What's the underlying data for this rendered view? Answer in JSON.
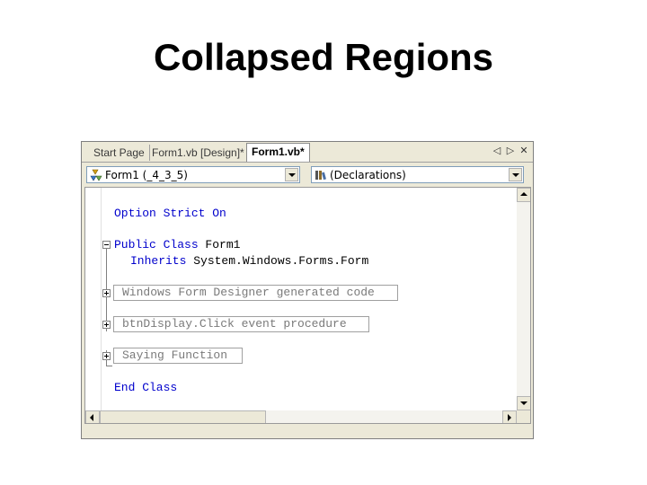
{
  "slide": {
    "title": "Collapsed Regions"
  },
  "tabs": [
    {
      "label": "Start Page",
      "active": false
    },
    {
      "label": "Form1.vb [Design]*",
      "active": false
    },
    {
      "label": "Form1.vb*",
      "active": true
    }
  ],
  "tab_controls": {
    "prev": "◁",
    "next": "▷",
    "close": "✕"
  },
  "class_combo": {
    "value": "Form1 (_4_3_5)",
    "icon": "class-icon"
  },
  "method_combo": {
    "value": "(Declarations)",
    "icon": "declarations-icon"
  },
  "code": {
    "option_kw": "Option Strict On",
    "class_kw": "Public Class",
    "class_name": " Form1",
    "inherits_kw": "Inherits",
    "inherits_name": " System.Windows.Forms.Form",
    "regions": [
      "Windows Form Designer generated code",
      "btnDisplay.Click event procedure",
      "Saying Function"
    ],
    "end_kw": "End Class"
  },
  "colors": {
    "keyword": "#0000cc",
    "region_text": "#7a7a7a"
  }
}
